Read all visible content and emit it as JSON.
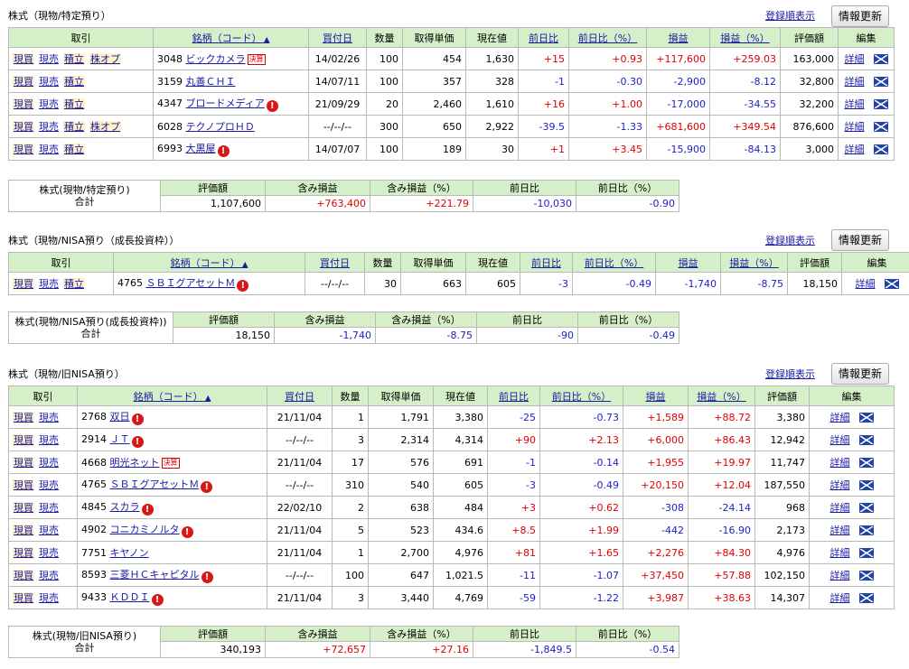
{
  "tokutei": {
    "title": "株式（現物/特定預り）",
    "sort_link": "登録順表示",
    "refresh_button": "情報更新",
    "headers": {
      "trade": "取引",
      "name": "銘柄（コード）",
      "buy_date": "買付日",
      "qty": "数量",
      "cost": "取得単価",
      "price": "現在値",
      "day_change": "前日比",
      "day_pct": "前日比（%）",
      "pl": "損益",
      "pl_pct": "損益（%）",
      "value": "評価額",
      "edit": "編集"
    },
    "rows": [
      {
        "trade": [
          "現買",
          "現売",
          "積立",
          "株オプ"
        ],
        "code": "3048",
        "name": "ビックカメラ",
        "badge": "決算",
        "alert": false,
        "buy_date": "14/02/26",
        "qty": "100",
        "cost": "454",
        "price": "1,630",
        "day_change": "+15",
        "day_pct": "+0.93",
        "pl": "+117,600",
        "pl_pct": "+259.03",
        "value": "163,000",
        "detail": "詳細"
      },
      {
        "trade": [
          "現買",
          "現売",
          "積立"
        ],
        "code": "3159",
        "name": "丸善ＣＨＩ",
        "badge": "",
        "alert": false,
        "buy_date": "14/07/11",
        "qty": "100",
        "cost": "357",
        "price": "328",
        "day_change": "-1",
        "day_pct": "-0.30",
        "pl": "-2,900",
        "pl_pct": "-8.12",
        "value": "32,800",
        "detail": "詳細"
      },
      {
        "trade": [
          "現買",
          "現売",
          "積立"
        ],
        "code": "4347",
        "name": "ブロードメディア",
        "badge": "",
        "alert": true,
        "buy_date": "21/09/29",
        "qty": "20",
        "cost": "2,460",
        "price": "1,610",
        "day_change": "+16",
        "day_pct": "+1.00",
        "pl": "-17,000",
        "pl_pct": "-34.55",
        "value": "32,200",
        "detail": "詳細"
      },
      {
        "trade": [
          "現買",
          "現売",
          "積立",
          "株オプ"
        ],
        "code": "6028",
        "name": "テクノプロＨＤ",
        "badge": "",
        "alert": false,
        "buy_date": "--/--/--",
        "qty": "300",
        "cost": "650",
        "price": "2,922",
        "day_change": "-39.5",
        "day_pct": "-1.33",
        "pl": "+681,600",
        "pl_pct": "+349.54",
        "value": "876,600",
        "detail": "詳細"
      },
      {
        "trade": [
          "現買",
          "現売",
          "積立"
        ],
        "code": "6993",
        "name": "大黒屋",
        "badge": "",
        "alert": true,
        "buy_date": "14/07/07",
        "qty": "100",
        "cost": "189",
        "price": "30",
        "day_change": "+1",
        "day_pct": "+3.45",
        "pl": "-15,900",
        "pl_pct": "-84.13",
        "value": "3,000",
        "detail": "詳細"
      }
    ],
    "summary": {
      "label": "株式(現物/特定預り)",
      "total_label": "合計",
      "headers": [
        "評価額",
        "含み損益",
        "含み損益（%）",
        "前日比",
        "前日比（%）"
      ],
      "values": [
        "1,107,600",
        "+763,400",
        "+221.79",
        "-10,030",
        "-0.90"
      ]
    }
  },
  "nisa_growth": {
    "title": "株式（現物/NISA預り（成長投資枠））",
    "sort_link": "登録順表示",
    "refresh_button": "情報更新",
    "rows": [
      {
        "trade": [
          "現買",
          "現売",
          "積立"
        ],
        "code": "4765",
        "name": "ＳＢＩグアセットＭ",
        "badge": "",
        "alert": true,
        "buy_date": "--/--/--",
        "qty": "30",
        "cost": "663",
        "price": "605",
        "day_change": "-3",
        "day_pct": "-0.49",
        "pl": "-1,740",
        "pl_pct": "-8.75",
        "value": "18,150",
        "detail": "詳細"
      }
    ],
    "summary": {
      "label": "株式(現物/NISA預り(成長投資枠))",
      "total_label": "合計",
      "values": [
        "18,150",
        "-1,740",
        "-8.75",
        "-90",
        "-0.49"
      ]
    }
  },
  "nisa_old": {
    "title": "株式（現物/旧NISA預り）",
    "sort_link": "登録順表示",
    "refresh_button": "情報更新",
    "rows": [
      {
        "trade": [
          "現買",
          "現売"
        ],
        "code": "2768",
        "name": "双日",
        "badge": "",
        "alert": true,
        "buy_date": "21/11/04",
        "qty": "1",
        "cost": "1,791",
        "price": "3,380",
        "day_change": "-25",
        "day_pct": "-0.73",
        "pl": "+1,589",
        "pl_pct": "+88.72",
        "value": "3,380",
        "detail": "詳細"
      },
      {
        "trade": [
          "現買",
          "現売"
        ],
        "code": "2914",
        "name": "ＪＴ",
        "badge": "",
        "alert": true,
        "buy_date": "--/--/--",
        "qty": "3",
        "cost": "2,314",
        "price": "4,314",
        "day_change": "+90",
        "day_pct": "+2.13",
        "pl": "+6,000",
        "pl_pct": "+86.43",
        "value": "12,942",
        "detail": "詳細"
      },
      {
        "trade": [
          "現買",
          "現売"
        ],
        "code": "4668",
        "name": "明光ネット",
        "badge": "決算",
        "alert": false,
        "buy_date": "21/11/04",
        "qty": "17",
        "cost": "576",
        "price": "691",
        "day_change": "-1",
        "day_pct": "-0.14",
        "pl": "+1,955",
        "pl_pct": "+19.97",
        "value": "11,747",
        "detail": "詳細"
      },
      {
        "trade": [
          "現買",
          "現売"
        ],
        "code": "4765",
        "name": "ＳＢＩグアセットＭ",
        "badge": "",
        "alert": true,
        "buy_date": "--/--/--",
        "qty": "310",
        "cost": "540",
        "price": "605",
        "day_change": "-3",
        "day_pct": "-0.49",
        "pl": "+20,150",
        "pl_pct": "+12.04",
        "value": "187,550",
        "detail": "詳細"
      },
      {
        "trade": [
          "現買",
          "現売"
        ],
        "code": "4845",
        "name": "スカラ",
        "badge": "",
        "alert": true,
        "buy_date": "22/02/10",
        "qty": "2",
        "cost": "638",
        "price": "484",
        "day_change": "+3",
        "day_pct": "+0.62",
        "pl": "-308",
        "pl_pct": "-24.14",
        "value": "968",
        "detail": "詳細"
      },
      {
        "trade": [
          "現買",
          "現売"
        ],
        "code": "4902",
        "name": "コニカミノルタ",
        "badge": "",
        "alert": true,
        "buy_date": "21/11/04",
        "qty": "5",
        "cost": "523",
        "price": "434.6",
        "day_change": "+8.5",
        "day_pct": "+1.99",
        "pl": "-442",
        "pl_pct": "-16.90",
        "value": "2,173",
        "detail": "詳細"
      },
      {
        "trade": [
          "現買",
          "現売"
        ],
        "code": "7751",
        "name": "キヤノン",
        "badge": "",
        "alert": false,
        "buy_date": "21/11/04",
        "qty": "1",
        "cost": "2,700",
        "price": "4,976",
        "day_change": "+81",
        "day_pct": "+1.65",
        "pl": "+2,276",
        "pl_pct": "+84.30",
        "value": "4,976",
        "detail": "詳細"
      },
      {
        "trade": [
          "現買",
          "現売"
        ],
        "code": "8593",
        "name": "三菱ＨＣキャピタル",
        "badge": "",
        "alert": true,
        "buy_date": "--/--/--",
        "qty": "100",
        "cost": "647",
        "price": "1,021.5",
        "day_change": "-11",
        "day_pct": "-1.07",
        "pl": "+37,450",
        "pl_pct": "+57.88",
        "value": "102,150",
        "detail": "詳細"
      },
      {
        "trade": [
          "現買",
          "現売"
        ],
        "code": "9433",
        "name": "ＫＤＤＩ",
        "badge": "",
        "alert": true,
        "buy_date": "21/11/04",
        "qty": "3",
        "cost": "3,440",
        "price": "4,769",
        "day_change": "-59",
        "day_pct": "-1.22",
        "pl": "+3,987",
        "pl_pct": "+38.63",
        "value": "14,307",
        "detail": "詳細"
      }
    ],
    "summary": {
      "label": "株式(現物/旧NISA預り)",
      "total_label": "合計",
      "values": [
        "340,193",
        "+72,657",
        "+27.16",
        "-1,849.5",
        "-0.54"
      ]
    }
  }
}
